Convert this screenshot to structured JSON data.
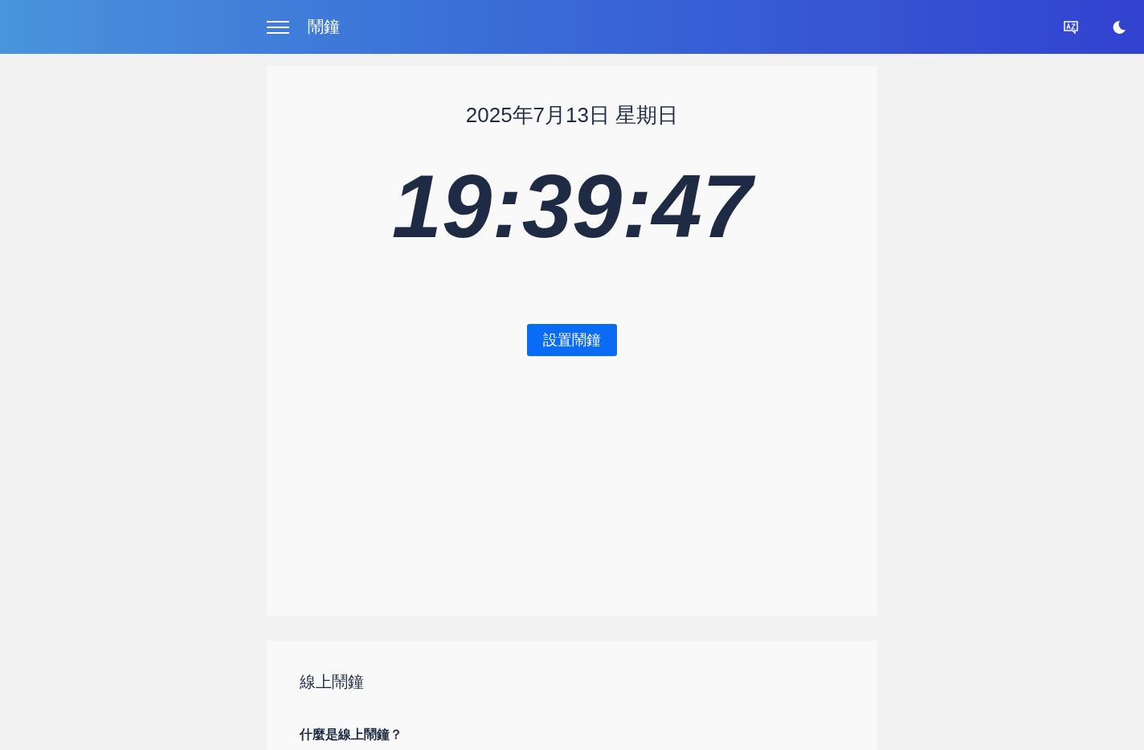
{
  "header": {
    "title": "鬧鐘"
  },
  "clock": {
    "date": "2025年7月13日 星期日",
    "time": "19:39:47",
    "button": "設置鬧鐘"
  },
  "article": {
    "title": "線上鬧鐘",
    "heading": "什麼是線上鬧鐘？"
  }
}
